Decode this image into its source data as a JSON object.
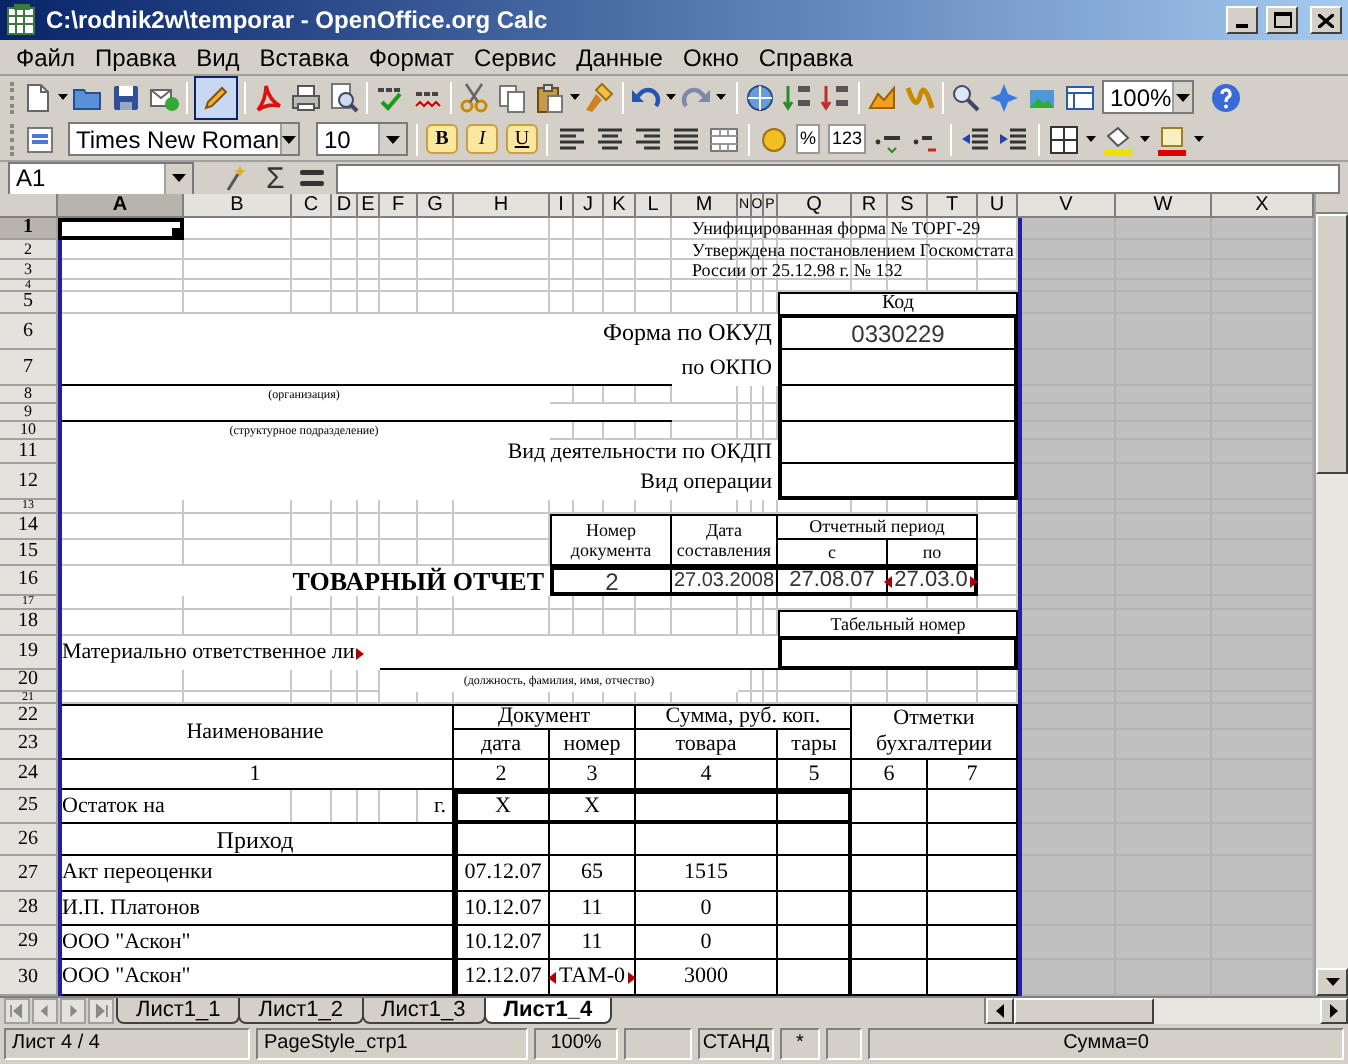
{
  "window": {
    "title": "C:\\rodnik2w\\temporar - OpenOffice.org Calc"
  },
  "menu": [
    "Файл",
    "Правка",
    "Вид",
    "Вставка",
    "Формат",
    "Сервис",
    "Данные",
    "Окно",
    "Справка"
  ],
  "toolbar": {
    "edit_mode_on": true,
    "zoom": "100%"
  },
  "formatting": {
    "font": "Times New Roman",
    "size": "10",
    "style_buttons": [
      "B",
      "I",
      "U"
    ],
    "number_buttons": [
      "%",
      "123"
    ]
  },
  "formula_bar": {
    "name_box": "A1",
    "sum_symbol": "Σ"
  },
  "columns": [
    {
      "label": "A",
      "selected": true
    },
    {
      "label": "B",
      "selected": false
    },
    {
      "label": "C",
      "selected": false
    },
    {
      "label": "D",
      "selected": false
    },
    {
      "label": "E",
      "selected": false
    },
    {
      "label": "F",
      "selected": false
    },
    {
      "label": "G",
      "selected": false
    },
    {
      "label": "H",
      "selected": false
    },
    {
      "label": "I",
      "selected": false
    },
    {
      "label": "J",
      "selected": false
    },
    {
      "label": "K",
      "selected": false
    },
    {
      "label": "L",
      "selected": false
    },
    {
      "label": "M",
      "selected": false
    },
    {
      "label": "N",
      "selected": false
    },
    {
      "label": "O",
      "selected": false
    },
    {
      "label": "P",
      "selected": false
    },
    {
      "label": "Q",
      "selected": false
    },
    {
      "label": "R",
      "selected": false
    },
    {
      "label": "S",
      "selected": false
    },
    {
      "label": "T",
      "selected": false
    },
    {
      "label": "U",
      "selected": false
    },
    {
      "label": "V",
      "selected": false
    },
    {
      "label": "W",
      "selected": false
    },
    {
      "label": "X",
      "selected": false
    }
  ],
  "rows": [
    {
      "number": "1",
      "selected": true,
      "cells": [
        "Унифицированная форма № ТОРГ-29"
      ]
    },
    {
      "number": "2",
      "selected": false,
      "cells": [
        "Утверждена постановлением Госкомстата"
      ]
    },
    {
      "number": "3",
      "selected": false,
      "cells": [
        "России от 25.12.98 г. № 132"
      ]
    },
    {
      "number": "4",
      "selected": false
    },
    {
      "number": "5",
      "selected": false,
      "cells": [
        "Код"
      ]
    },
    {
      "number": "6",
      "selected": false,
      "cells": [
        "Форма по ОКУД",
        "0330229"
      ]
    },
    {
      "number": "7",
      "selected": false,
      "cells": [
        "по ОКПО"
      ]
    },
    {
      "number": "8",
      "selected": false,
      "cells": [
        "(организация)"
      ]
    },
    {
      "number": "9",
      "selected": false
    },
    {
      "number": "10",
      "selected": false,
      "cells": [
        "(структурное подразделение)"
      ]
    },
    {
      "number": "11",
      "selected": false,
      "cells": [
        "Вид деятельности по ОКДП"
      ]
    },
    {
      "number": "12",
      "selected": false,
      "cells": [
        "Вид операции"
      ]
    },
    {
      "number": "13",
      "selected": false
    },
    {
      "number": "14",
      "selected": false,
      "cells": [
        "Номер документа",
        "Дата составления",
        "Отчетный период"
      ]
    },
    {
      "number": "15",
      "selected": false,
      "cells": [
        "с",
        "по"
      ]
    },
    {
      "number": "16",
      "selected": false,
      "cells": [
        "ТОВАРНЫЙ  ОТЧЕТ",
        "2",
        "27.03.2008",
        "27.08.07",
        "27.03.0"
      ]
    },
    {
      "number": "17",
      "selected": false
    },
    {
      "number": "18",
      "selected": false,
      "cells": [
        "Табельный номер"
      ]
    },
    {
      "number": "19",
      "selected": false,
      "cells": [
        "Материально ответственное ли"
      ]
    },
    {
      "number": "20",
      "selected": false,
      "cells": [
        "(должность, фамилия, имя, отчество)"
      ]
    },
    {
      "number": "21",
      "selected": false
    },
    {
      "number": "22",
      "selected": false,
      "cells": [
        "Наименование",
        "Документ",
        "Сумма, руб. коп.",
        "Отметки бухгалтерии"
      ]
    },
    {
      "number": "23",
      "selected": false,
      "cells": [
        "дата",
        "номер",
        "товара",
        "тары"
      ]
    },
    {
      "number": "24",
      "selected": false,
      "cells": [
        "1",
        "2",
        "3",
        "4",
        "5",
        "6",
        "7"
      ]
    },
    {
      "number": "25",
      "selected": false,
      "cells": [
        "Остаток на",
        "г.",
        "Х",
        "Х"
      ]
    },
    {
      "number": "26",
      "selected": false,
      "cells": [
        "Приход"
      ]
    },
    {
      "number": "27",
      "selected": false,
      "cells": [
        "Акт переоценки",
        "07.12.07",
        "65",
        "1515"
      ]
    },
    {
      "number": "28",
      "selected": false,
      "cells": [
        "И.П. Платонов",
        "10.12.07",
        "11",
        "0"
      ]
    },
    {
      "number": "29",
      "selected": false,
      "cells": [
        "ООО \"Аскон\"",
        "10.12.07",
        "11",
        "0"
      ]
    },
    {
      "number": "30",
      "selected": false,
      "cells": [
        "ООО \"Аскон\"",
        "12.12.07",
        "ТАМ-0",
        "3000"
      ]
    }
  ],
  "sheet_tabs": [
    {
      "label": "Лист1_1",
      "selected": false
    },
    {
      "label": "Лист1_2",
      "selected": false
    },
    {
      "label": "Лист1_3",
      "selected": false
    },
    {
      "label": "Лист1_4",
      "selected": true
    }
  ],
  "status_bar": {
    "sheet": "Лист 4 / 4",
    "page_style": "PageStyle_стр1",
    "zoom": "100%",
    "mode": "СТАНД",
    "modified": "*",
    "sum": "Сумма=0"
  }
}
